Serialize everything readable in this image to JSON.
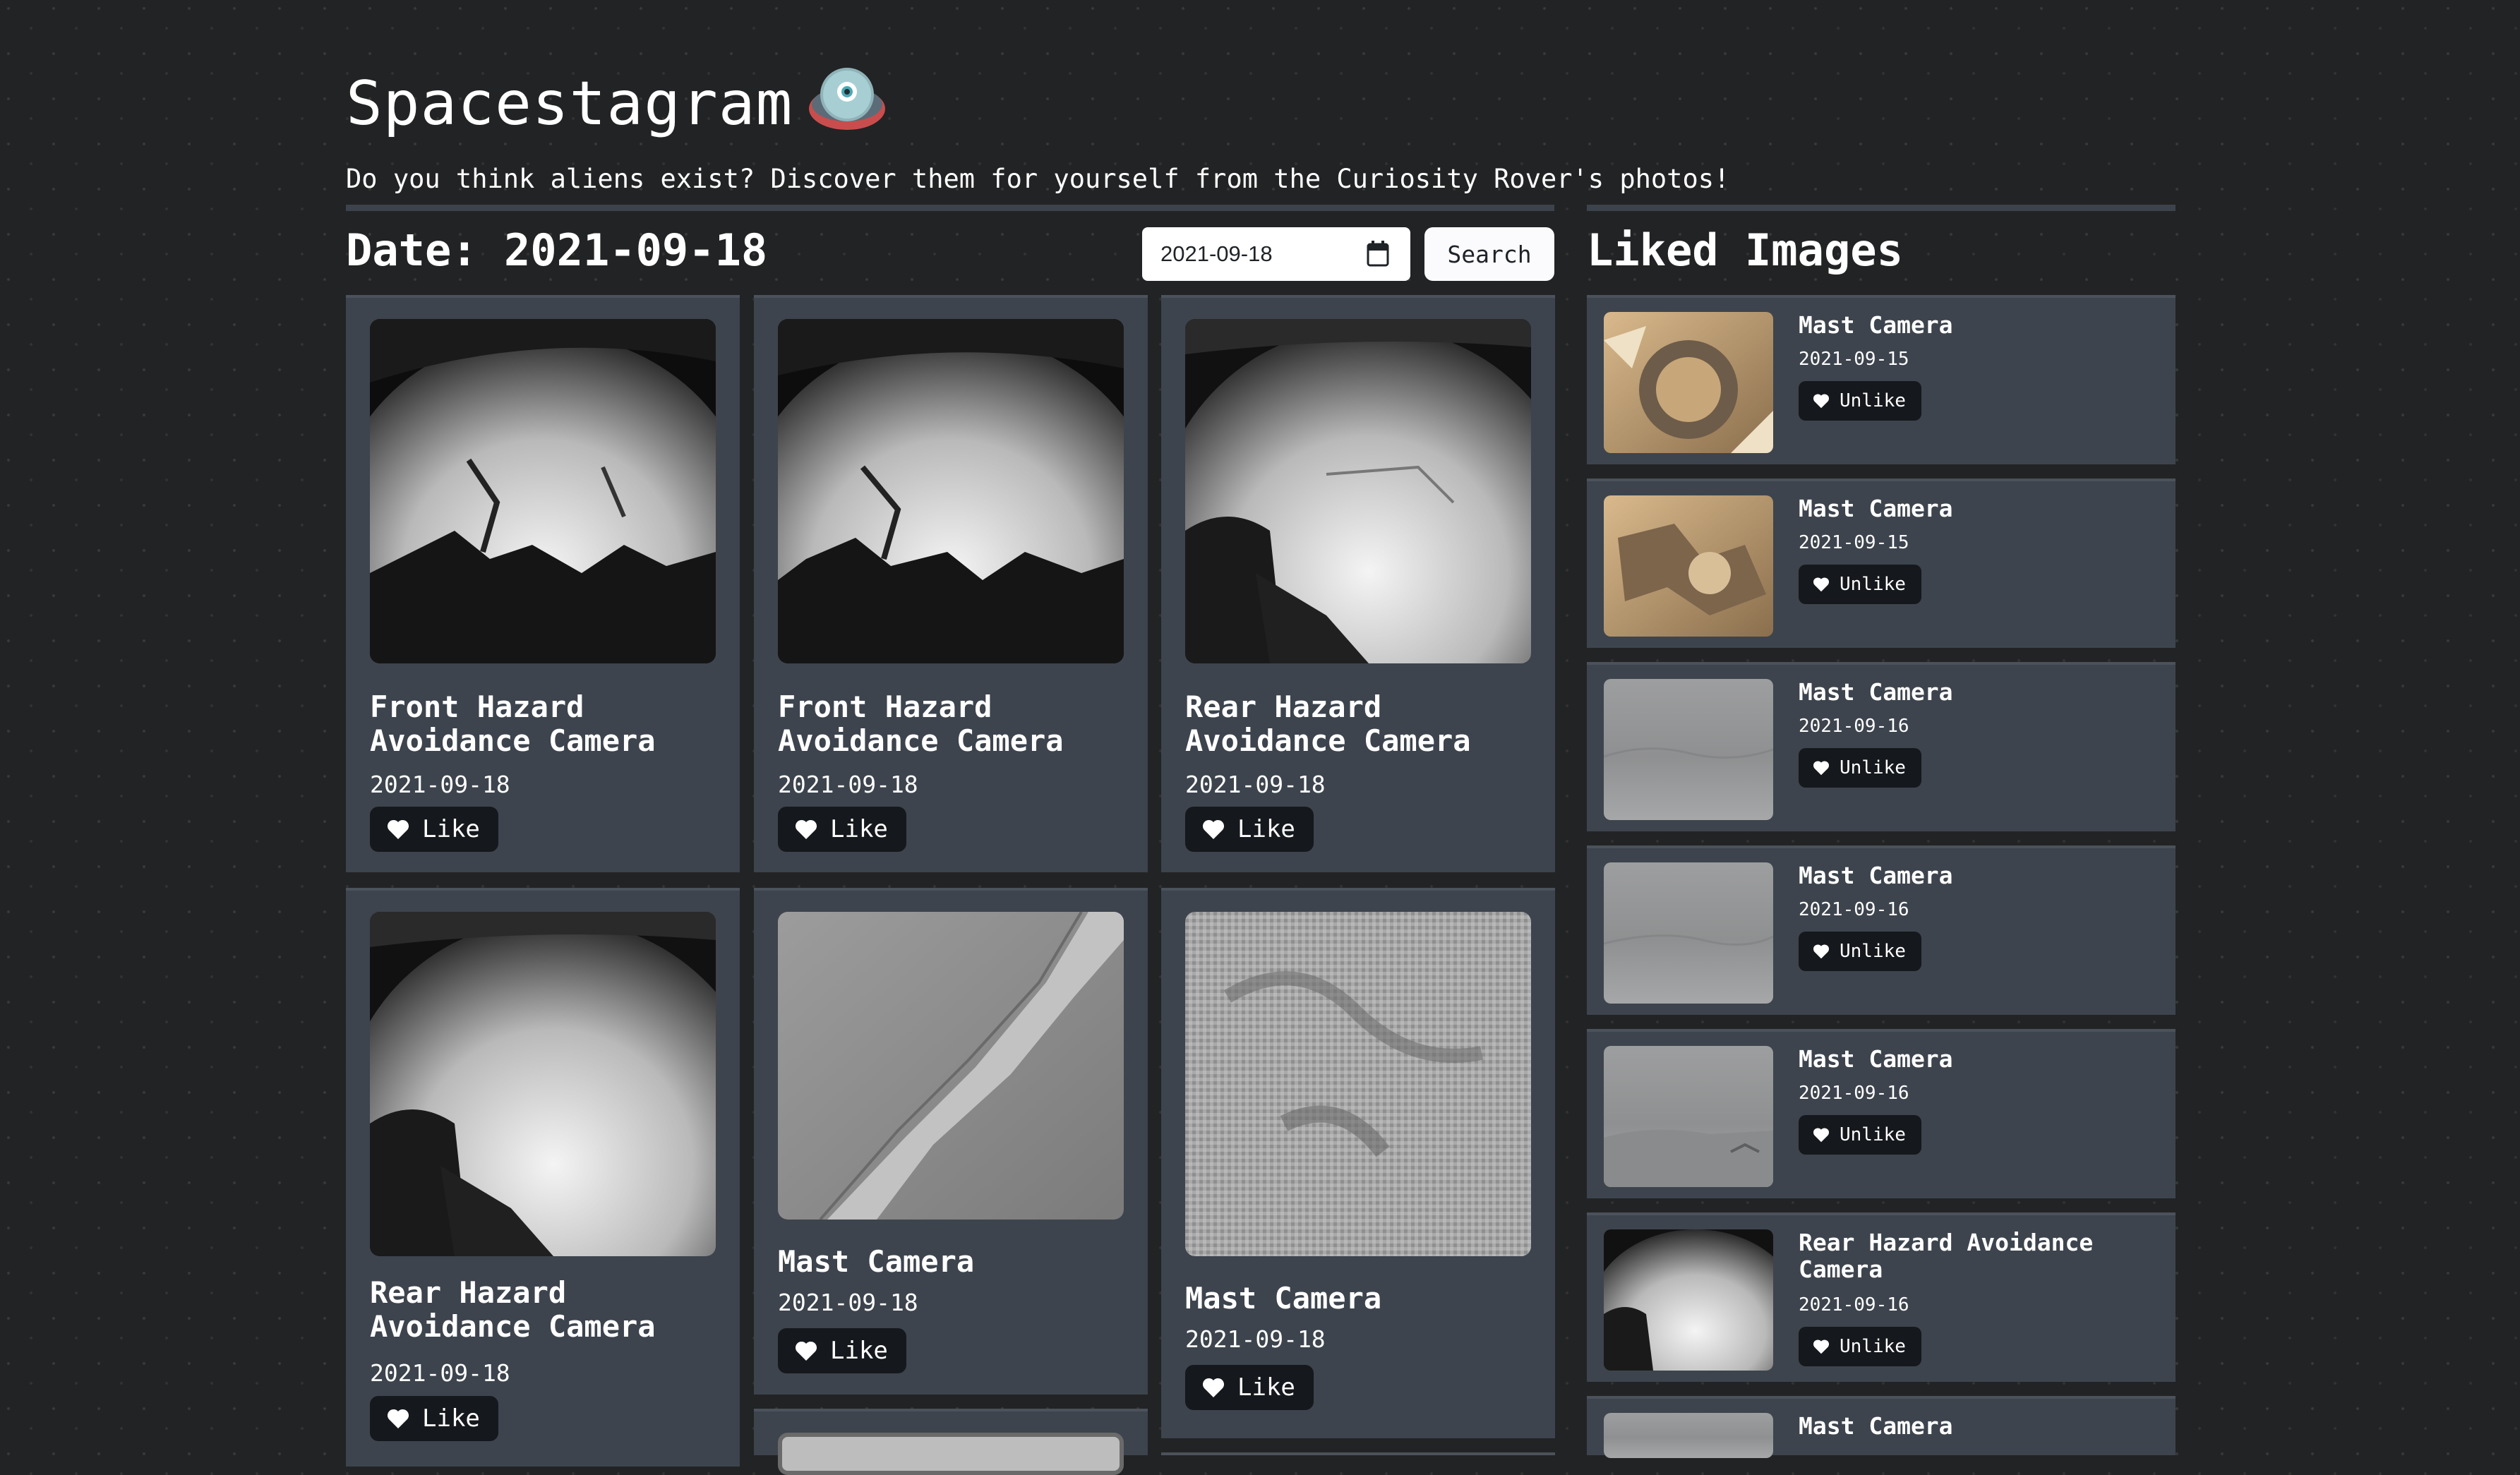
{
  "header": {
    "title": "Spacestagram",
    "logo_icon": "ufo-icon",
    "tagline": "Do you think aliens exist? Discover them for yourself from the Curiosity Rover's photos!"
  },
  "search": {
    "heading": "Date: 2021-09-18",
    "date_value": "2021-09-18",
    "search_label": "Search"
  },
  "photos": [
    {
      "camera": "Front Hazard Avoidance Camera",
      "date": "2021-09-18",
      "action": "Like"
    },
    {
      "camera": "Front Hazard Avoidance Camera",
      "date": "2021-09-18",
      "action": "Like"
    },
    {
      "camera": "Rear Hazard Avoidance Camera",
      "date": "2021-09-18",
      "action": "Like"
    },
    {
      "camera": "Rear Hazard Avoidance Camera",
      "date": "2021-09-18",
      "action": "Like"
    },
    {
      "camera": "Mast Camera",
      "date": "2021-09-18",
      "action": "Like"
    },
    {
      "camera": "Mast Camera",
      "date": "2021-09-18",
      "action": "Like"
    }
  ],
  "liked": {
    "heading": "Liked Images",
    "items": [
      {
        "camera": "Mast Camera",
        "date": "2021-09-15",
        "action": "Unlike"
      },
      {
        "camera": "Mast Camera",
        "date": "2021-09-15",
        "action": "Unlike"
      },
      {
        "camera": "Mast Camera",
        "date": "2021-09-16",
        "action": "Unlike"
      },
      {
        "camera": "Mast Camera",
        "date": "2021-09-16",
        "action": "Unlike"
      },
      {
        "camera": "Mast Camera",
        "date": "2021-09-16",
        "action": "Unlike"
      },
      {
        "camera": "Rear Hazard Avoidance Camera",
        "date": "2021-09-16",
        "action": "Unlike"
      },
      {
        "camera": "Mast Camera",
        "date": "",
        "action": ""
      }
    ]
  },
  "colors": {
    "background": "#222324",
    "card": "#3d444d",
    "button_dark": "#15181c",
    "text": "#ffffff"
  }
}
